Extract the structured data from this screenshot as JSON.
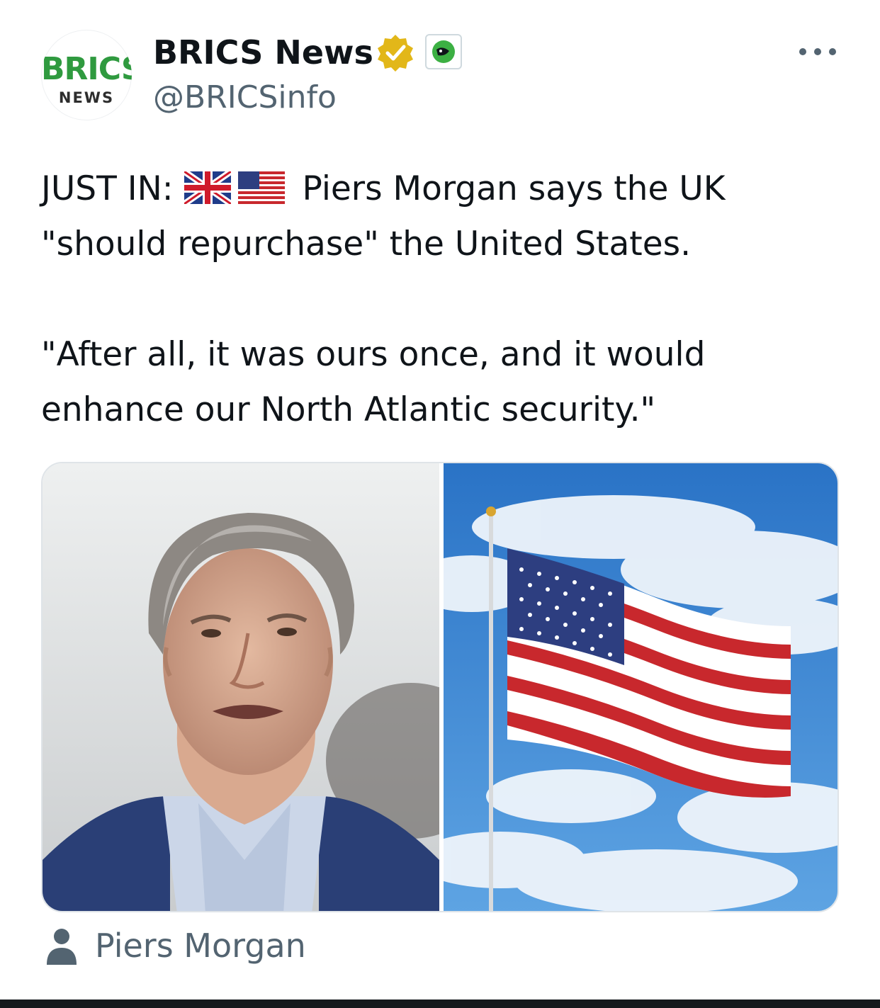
{
  "author": {
    "display_name": "BRICS News",
    "handle": "@BRICSinfo",
    "avatar_logo_top": "BRICS",
    "avatar_logo_bottom": "NEWS",
    "verified_badge": "gold-verified-icon",
    "affiliate_badge": "affiliate-badge-icon"
  },
  "menu": {
    "icon": "more-options-icon"
  },
  "tweet": {
    "line1_prefix": "JUST IN:",
    "line1_flags": [
      "uk-flag-emoji",
      "us-flag-emoji"
    ],
    "line1_rest": "Piers Morgan says the UK",
    "line2": "\"should repurchase\" the United States.",
    "line3": "\"After all, it was ours once, and it would",
    "line4": "enhance our North Atlantic security.\""
  },
  "media": {
    "images": [
      {
        "name": "piers-morgan-photo"
      },
      {
        "name": "us-flag-photo"
      }
    ]
  },
  "tagged_person": {
    "icon": "person-icon",
    "label": "Piers Morgan"
  },
  "colors": {
    "text_primary": "#0f1419",
    "text_secondary": "#536471",
    "verified_gold": "#e2b719",
    "brics_green": "#2f9a3f"
  }
}
